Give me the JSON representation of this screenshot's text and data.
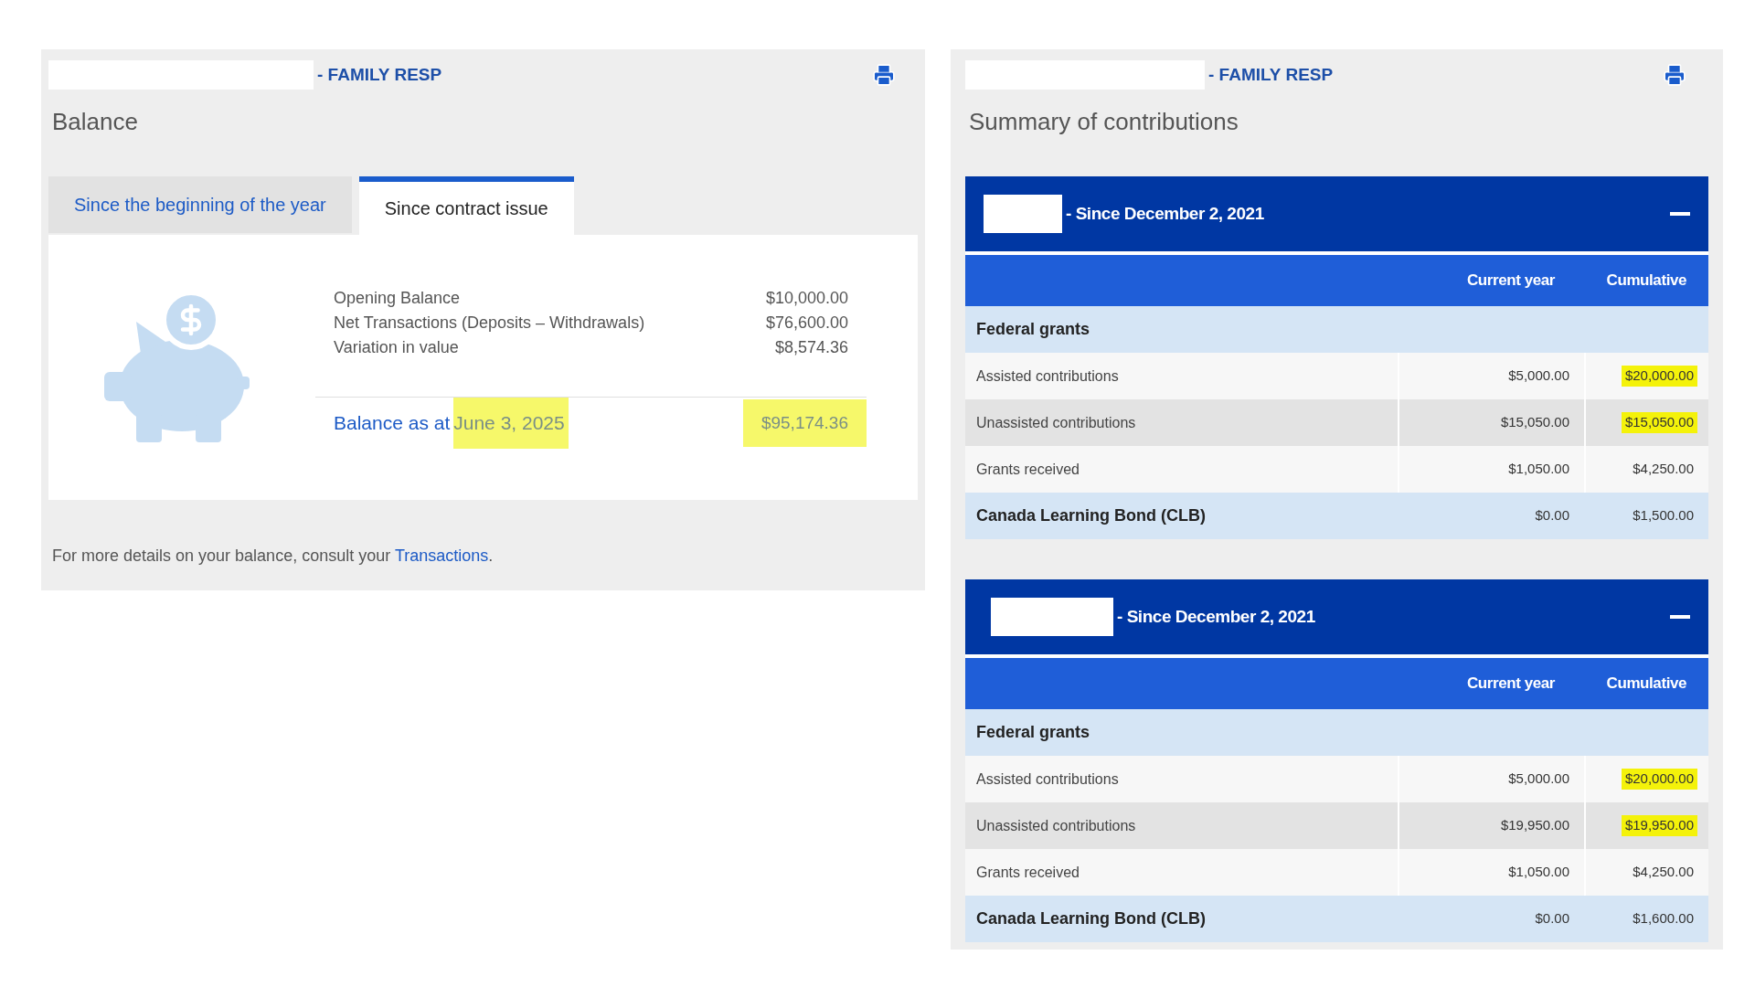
{
  "balance_panel": {
    "account_suffix": "- FAMILY RESP",
    "title": "Balance",
    "tabs": [
      {
        "label": "Since the beginning of the year",
        "selected": false
      },
      {
        "label": "Since contract issue",
        "selected": true
      }
    ],
    "lines": [
      {
        "label": "Opening Balance",
        "value": "$10,000.00"
      },
      {
        "label": "Net Transactions (Deposits – Withdrawals)",
        "value": "$76,600.00"
      },
      {
        "label": "Variation in value",
        "value": "$8,574.36"
      }
    ],
    "total": {
      "label": "Balance as at",
      "date": "June 3, 2025",
      "date_highlighted": true,
      "value": "$95,174.36",
      "value_highlighted": true
    },
    "footer": {
      "text": "For more details on your balance, consult your",
      "link": "Transactions",
      "end": "."
    }
  },
  "summary_panel": {
    "account_suffix": "- FAMILY RESP",
    "title": "Summary of contributions",
    "sections": [
      {
        "heading": "- Since December 2, 2021",
        "expanded": true,
        "columns": [
          "Current year",
          "Cumulative"
        ],
        "rows": [
          {
            "kind": "group",
            "label": "Federal grants"
          },
          {
            "kind": "item",
            "label": "Assisted contributions",
            "current_year": "$5,000.00",
            "cumulative": "$20,000.00",
            "highlighted": true
          },
          {
            "kind": "item",
            "label": "Unassisted contributions",
            "current_year": "$15,050.00",
            "cumulative": "$15,050.00",
            "highlighted": true
          },
          {
            "kind": "item",
            "label": "Grants received",
            "current_year": "$1,050.00",
            "cumulative": "$4,250.00",
            "highlighted": false
          },
          {
            "kind": "group",
            "label": "Canada Learning Bond (CLB)",
            "current_year": "$0.00",
            "cumulative": "$1,500.00",
            "highlighted": false
          }
        ]
      },
      {
        "heading": "- Since December 2, 2021",
        "expanded": true,
        "columns": [
          "Current year",
          "Cumulative"
        ],
        "rows": [
          {
            "kind": "group",
            "label": "Federal grants"
          },
          {
            "kind": "item",
            "label": "Assisted contributions",
            "current_year": "$5,000.00",
            "cumulative": "$20,000.00",
            "highlighted": true
          },
          {
            "kind": "item",
            "label": "Unassisted contributions",
            "current_year": "$19,950.00",
            "cumulative": "$19,950.00",
            "highlighted": true
          },
          {
            "kind": "item",
            "label": "Grants received",
            "current_year": "$1,050.00",
            "cumulative": "$4,250.00",
            "highlighted": false
          },
          {
            "kind": "group",
            "label": "Canada Learning Bond (CLB)",
            "current_year": "$0.00",
            "cumulative": "$1,600.00",
            "highlighted": false
          }
        ]
      }
    ]
  }
}
